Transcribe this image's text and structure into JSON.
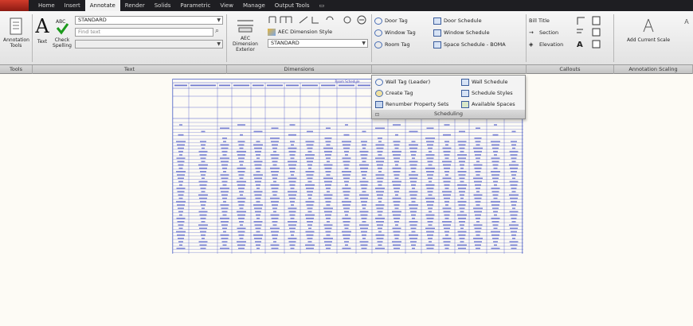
{
  "tabs": [
    {
      "label": "Home",
      "active": false
    },
    {
      "label": "Insert",
      "active": false
    },
    {
      "label": "Annotate",
      "active": true
    },
    {
      "label": "Render",
      "active": false
    },
    {
      "label": "Solids",
      "active": false
    },
    {
      "label": "Parametric",
      "active": false
    },
    {
      "label": "View",
      "active": false
    },
    {
      "label": "Manage",
      "active": false
    },
    {
      "label": "Output Tools",
      "active": false
    }
  ],
  "tools_panel": {
    "annotation_tools": "Annotation Tools",
    "label": "Tools"
  },
  "text_panel": {
    "text_btn": "Text",
    "check_spelling": "Check Spelling",
    "style_value": "STANDARD",
    "find_placeholder": "Find text",
    "label": "Text"
  },
  "dimensions_panel": {
    "aec_dimension": "AEC Dimension Exterior",
    "aec_dim_style": "AEC Dimension Style",
    "dim_style_value": "STANDARD",
    "label": "Dimensions"
  },
  "tags": {
    "door_tag": "Door Tag",
    "window_tag": "Window Tag",
    "room_tag": "Room Tag",
    "door_schedule": "Door Schedule",
    "window_schedule": "Window Schedule",
    "space_schedule": "Space Schedule - BOMA"
  },
  "callouts_panel": {
    "bill_title": "Bill Title",
    "section": "Section",
    "elevation": "Elevation",
    "label": "Callouts"
  },
  "scaling_panel": {
    "add_current_scale": "Add Current Scale",
    "label": "Annotation Scaling"
  },
  "scheduling_dropdown": {
    "wall_tag": "Wall Tag (Leader)",
    "wall_schedule": "Wall Schedule",
    "create_tag": "Create Tag",
    "schedule_styles": "Schedule Styles",
    "renumber": "Renumber Property Sets",
    "available_spaces": "Available Spaces",
    "title": "Scheduling"
  },
  "schedule_sheet": {
    "title": "Room Schedule"
  },
  "colors": {
    "tabbar": "#1e1e22",
    "ribbon": "#ececec",
    "drawing_bg": "#fdfbf5",
    "table_lines": "#4a58c8"
  }
}
